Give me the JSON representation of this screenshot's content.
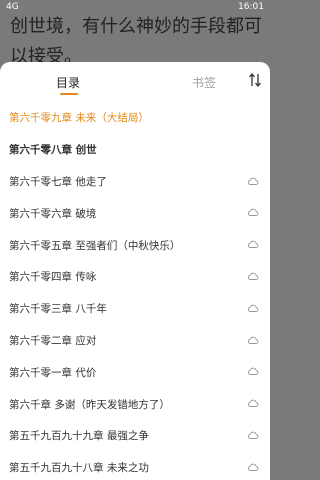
{
  "status": {
    "signal": "4G",
    "time": "16:01"
  },
  "reader": {
    "text": "创世境，有什么神妙的手段都可以接受。"
  },
  "tabs": {
    "toc": "目录",
    "bookmarks": "书签"
  },
  "accent": "#e28a1c",
  "chapters": [
    {
      "title": "第六千零九章 未来（大结局）",
      "state": "current",
      "cloud": false
    },
    {
      "title": "第六千零八章 创世",
      "state": "bold",
      "cloud": false
    },
    {
      "title": "第六千零七章 他走了",
      "state": "normal",
      "cloud": true
    },
    {
      "title": "第六千零六章 破境",
      "state": "normal",
      "cloud": true
    },
    {
      "title": "第六千零五章 至强者们（中秋快乐）",
      "state": "normal",
      "cloud": true
    },
    {
      "title": "第六千零四章 传咏",
      "state": "normal",
      "cloud": true
    },
    {
      "title": "第六千零三章 八千年",
      "state": "normal",
      "cloud": true
    },
    {
      "title": "第六千零二章 应对",
      "state": "normal",
      "cloud": true
    },
    {
      "title": "第六千零一章 代价",
      "state": "normal",
      "cloud": true
    },
    {
      "title": "第六千章 多谢（昨天发错地方了）",
      "state": "normal",
      "cloud": true
    },
    {
      "title": "第五千九百九十九章 最强之争",
      "state": "normal",
      "cloud": true
    },
    {
      "title": "第五千九百九十八章 未来之功",
      "state": "normal",
      "cloud": true
    }
  ]
}
